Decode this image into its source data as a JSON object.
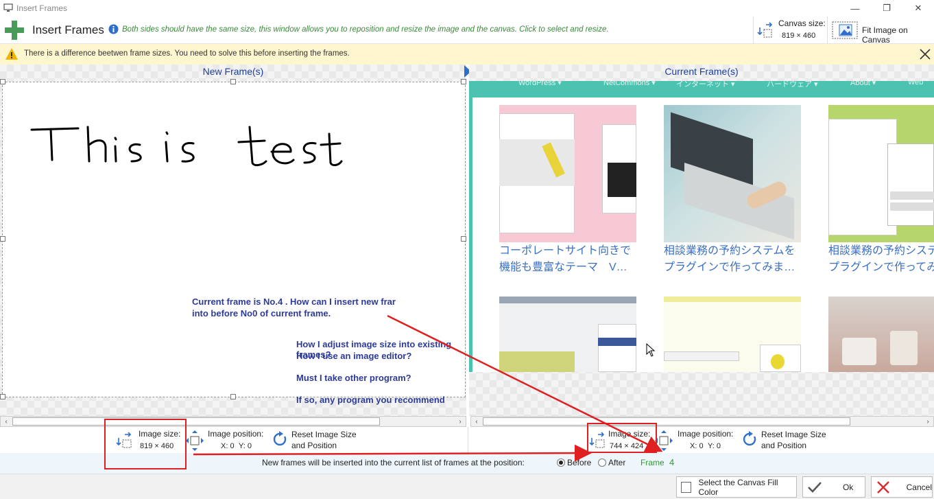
{
  "window": {
    "title": "Insert Frames",
    "minimize": "—",
    "maximize": "❐",
    "close": "✕"
  },
  "header": {
    "title": "Insert Frames",
    "description": "Both sides should have the same size, this window allows you to reposition and resize the image and the canvas. Click to select and resize.",
    "canvas_size_label": "Canvas size:",
    "canvas_size_value": "819 × 460",
    "fit_label": "Fit Image on Canvas"
  },
  "warning": {
    "text": "There is a difference beetwen frame sizes. You need to solve this before inserting the frames."
  },
  "left_panel": {
    "title": "New Frame(s)",
    "handwriting": "This is test.",
    "notes": [
      "Current frame is No.4 . How can I insert new frar",
      "into before No0 of current frame.",
      "How I adjust   image size into  existing frames?",
      "How I use an image editor?",
      "Must I take other program?",
      "If so, any program you recommend"
    ],
    "image_size_label": "Image size:",
    "image_size_value": "819 × 460",
    "image_position_label": "Image position:",
    "x_label": "X: 0",
    "y_label": "Y: 0",
    "reset_label_1": "Reset Image Size",
    "reset_label_2": "and Position"
  },
  "right_panel": {
    "title": "Current Frame(s)",
    "menu": [
      "WordPress ▾",
      "NetCommons ▾",
      "インターネット ▾",
      "ハードウェア ▾",
      "About ▾",
      "Web"
    ],
    "cards": [
      {
        "caption1": "コーポレートサイト向きで",
        "caption2": "機能も豊富なテーマ　V…"
      },
      {
        "caption1": "相談業務の予約システムを",
        "caption2": "プラグインで作ってみま…"
      },
      {
        "caption1": "相談業務の予約システ",
        "caption2": "プラグインで作ってみ"
      }
    ],
    "image_size_label": "Image size:",
    "image_size_value": "744 × 424",
    "image_position_label": "Image position:",
    "x_label": "X: 0",
    "y_label": "Y: 0",
    "reset_label_1": "Reset Image Size",
    "reset_label_2": "and Position"
  },
  "insert_position": {
    "text": "New frames will be inserted into the current list of frames at the position:",
    "before": "Before",
    "after": "After",
    "frame_label": "Frame",
    "frame_value": "4"
  },
  "buttons": {
    "canvas_fill": "Select the Canvas Fill Color",
    "ok": "Ok",
    "cancel": "Cancel"
  },
  "colors": {
    "accent_blue": "#1a3f9a",
    "teal": "#4cc3b0",
    "annotation_red": "#e02020",
    "green": "#2f9a2f"
  }
}
